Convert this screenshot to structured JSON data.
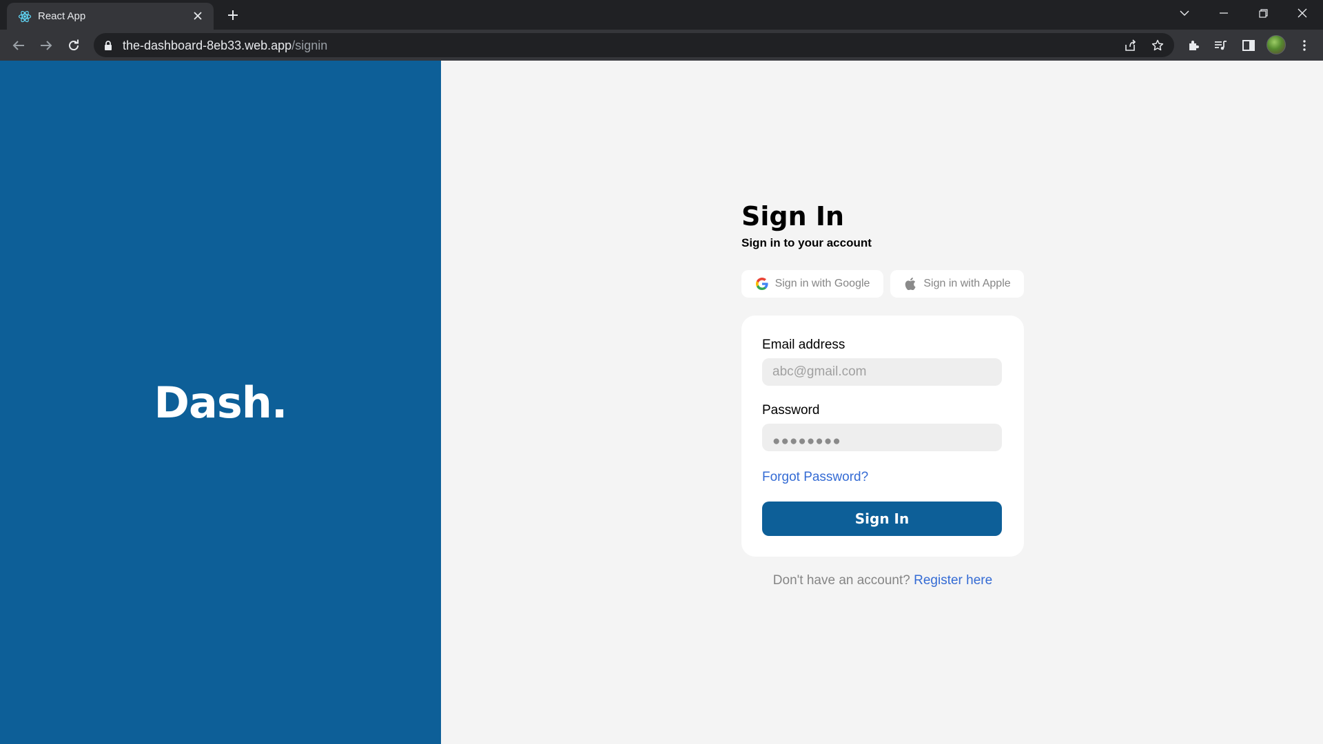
{
  "browser": {
    "tab_title": "React App",
    "url_host": "the-dashboard-8eb33.web.app",
    "url_path": "/signin"
  },
  "brand_panel": {
    "logo_text": "Dash.",
    "background": "#0d5f98"
  },
  "signin": {
    "title": "Sign In",
    "subtitle": "Sign in to your account",
    "google_button": "Sign in with Google",
    "apple_button": "Sign in with Apple",
    "email_label": "Email address",
    "email_placeholder": "abc@gmail.com",
    "password_label": "Password",
    "password_mask": "●●●●●●●●",
    "forgot_password": "Forgot Password?",
    "submit_label": "Sign In",
    "register_prompt": "Don't have an account?",
    "register_link": "Register here"
  },
  "colors": {
    "accent": "#0d5f98",
    "link": "#346bd4",
    "page_background": "#f4f4f4"
  }
}
